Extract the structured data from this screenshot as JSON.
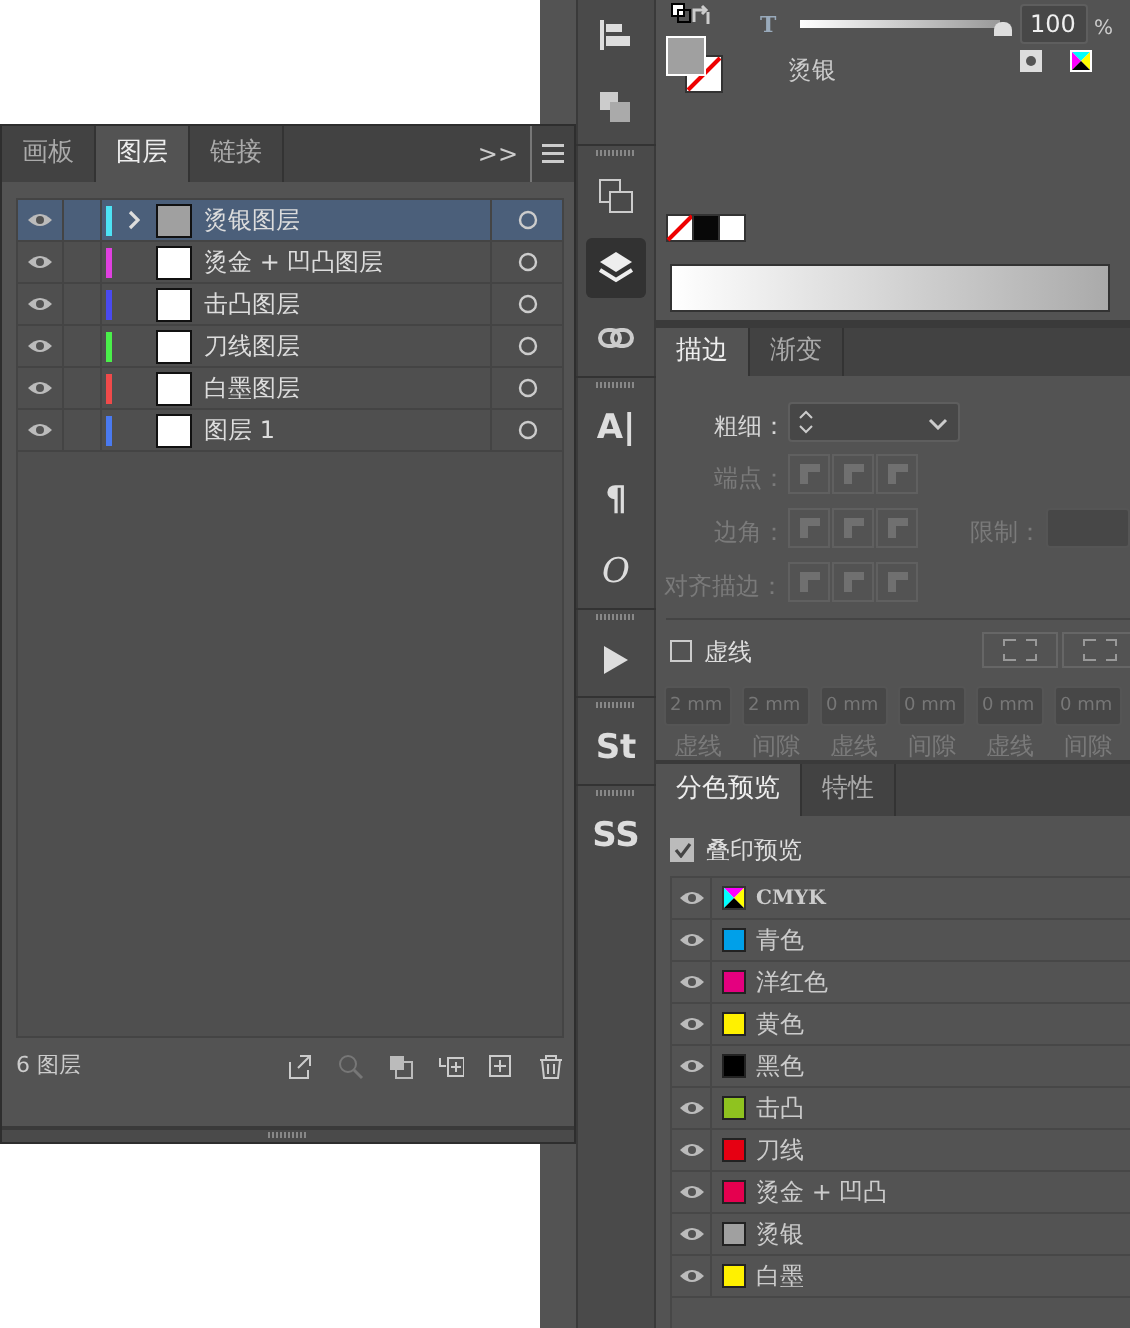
{
  "layers_panel": {
    "tabs": [
      {
        "label": "画板",
        "selected": false
      },
      {
        "label": "图层",
        "selected": true
      },
      {
        "label": "链接",
        "selected": false
      }
    ],
    "overflow": ">>",
    "layers": [
      {
        "name": "烫银图层",
        "color": "#4de3f5",
        "selected": true,
        "expandable": true,
        "thumb": {
          "color": "#a0a0a0"
        }
      },
      {
        "name": "烫金 + 凹凸图层",
        "color": "#e040e0",
        "selected": false,
        "expandable": false,
        "thumb": {
          "color": "#ffffff"
        }
      },
      {
        "name": "击凸图层",
        "color": "#4a4af0",
        "selected": false,
        "expandable": false,
        "thumb": {
          "color": "#ffffff"
        }
      },
      {
        "name": "刀线图层",
        "color": "#4af04a",
        "selected": false,
        "expandable": false,
        "thumb": {
          "color": "#ffffff"
        }
      },
      {
        "name": "白墨图层",
        "color": "#f04a4a",
        "selected": false,
        "expandable": false,
        "thumb": {
          "color": "#ffffff"
        }
      },
      {
        "name": "图层 1",
        "color": "#4a7af0",
        "selected": false,
        "expandable": false,
        "thumb": {
          "color": "#ffffff"
        }
      }
    ],
    "count": "6 图层"
  },
  "tool_strip": [
    {
      "kind": "align"
    },
    {
      "kind": "pathfinder"
    },
    {
      "kind": "grip"
    },
    {
      "kind": "artboards"
    },
    {
      "kind": "layers",
      "selected": true
    },
    {
      "kind": "links"
    },
    {
      "kind": "grip"
    },
    {
      "kind": "glyph",
      "glyph": "A|"
    },
    {
      "kind": "glyph",
      "glyph": "¶"
    },
    {
      "kind": "glyph",
      "glyph": "O",
      "italic": true
    },
    {
      "kind": "grip"
    },
    {
      "kind": "play"
    },
    {
      "kind": "grip"
    },
    {
      "kind": "glyph",
      "glyph": "St"
    },
    {
      "kind": "grip"
    },
    {
      "kind": "glyph",
      "glyph": "SS"
    }
  ],
  "color_panel": {
    "tint_label": "T",
    "tint": {
      "level": 1.0
    },
    "tint_value": "100",
    "percent": "%",
    "swatch_name": "烫银",
    "fill": {
      "color": "#a0a0a0"
    }
  },
  "stroke_panel": {
    "tabs": [
      {
        "label": "描边",
        "selected": true
      },
      {
        "label": "渐变",
        "selected": false
      }
    ],
    "weight_label": "粗细：",
    "cap_label": "端点：",
    "corner_label": "边角：",
    "limit_label": "限制：",
    "align_label": "对齐描边：",
    "dashed": {
      "label": "虚线",
      "checked": false
    },
    "dash_fields": [
      {
        "value": "2 mm",
        "label": "虚线"
      },
      {
        "value": "2 mm",
        "label": "间隙"
      },
      {
        "value": "0 mm",
        "label": "虚线"
      },
      {
        "value": "0 mm",
        "label": "间隙"
      },
      {
        "value": "0 mm",
        "label": "虚线"
      },
      {
        "value": "0 mm",
        "label": "间隙"
      }
    ]
  },
  "separations_panel": {
    "tabs": [
      {
        "label": "分色预览",
        "selected": true
      },
      {
        "label": "特性",
        "selected": false
      }
    ],
    "overprint": {
      "label": "叠印预览",
      "checked": true
    },
    "inks": [
      {
        "name": "CMYK",
        "kind": "process"
      },
      {
        "name": "青色",
        "kind": "spot",
        "color": "#00a0e9"
      },
      {
        "name": "洋红色",
        "kind": "spot",
        "color": "#e4007f"
      },
      {
        "name": "黄色",
        "kind": "spot",
        "color": "#fff100"
      },
      {
        "name": "黑色",
        "kind": "spot",
        "color": "#000000"
      },
      {
        "name": "击凸",
        "kind": "spot",
        "color": "#8fc31f"
      },
      {
        "name": "刀线",
        "kind": "spot",
        "color": "#e60012"
      },
      {
        "name": "烫金 + 凹凸",
        "kind": "spot",
        "color": "#e5004f"
      },
      {
        "name": "烫银",
        "kind": "spot",
        "color": "#a0a0a0"
      },
      {
        "name": "白墨",
        "kind": "spot",
        "color": "#fff100"
      }
    ]
  }
}
